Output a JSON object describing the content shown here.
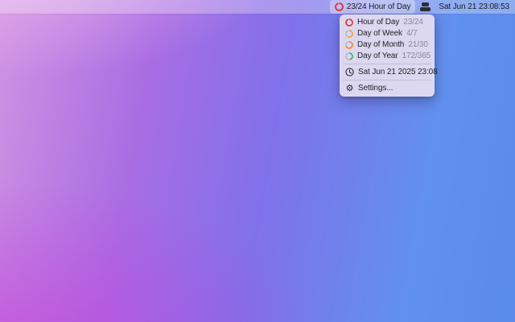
{
  "theme": {
    "ring_track": "rgba(125,120,142,0.30)",
    "menu_background": "rgba(226,220,239,0.95)",
    "label_color": "#1e1e24",
    "value_color": "#8b8798"
  },
  "menubar": {
    "active_item": {
      "label": "23/24 Hour of Day",
      "icon": "progress-ring-icon",
      "ring": {
        "color": "#e0383e",
        "fraction": 0.958
      }
    },
    "extra_icon": "stack-icon",
    "clock": "Sat Jun 21 23:08:53"
  },
  "menu": {
    "stats": [
      {
        "label": "Hour of Day",
        "value": "23/24",
        "icon": "progress-ring-icon",
        "ring": {
          "color": "#e0383e",
          "fraction": 0.958
        }
      },
      {
        "label": "Day of Week",
        "value": "4/7",
        "icon": "progress-ring-icon",
        "ring": {
          "color": "#f1a33b",
          "fraction": 0.571
        }
      },
      {
        "label": "Day of Month",
        "value": "21/30",
        "icon": "progress-ring-icon",
        "ring": {
          "color": "#ee8a2f",
          "fraction": 0.7
        }
      },
      {
        "label": "Day of Year",
        "value": "172/365",
        "icon": "progress-ring-icon",
        "ring": {
          "color": "#35bd66",
          "fraction": 0.471
        }
      }
    ],
    "datetime": {
      "label": "Sat Jun 21 2025 23:08",
      "icon": "clock-icon"
    },
    "settings": {
      "label": "Settings...",
      "icon": "gear-icon"
    }
  }
}
